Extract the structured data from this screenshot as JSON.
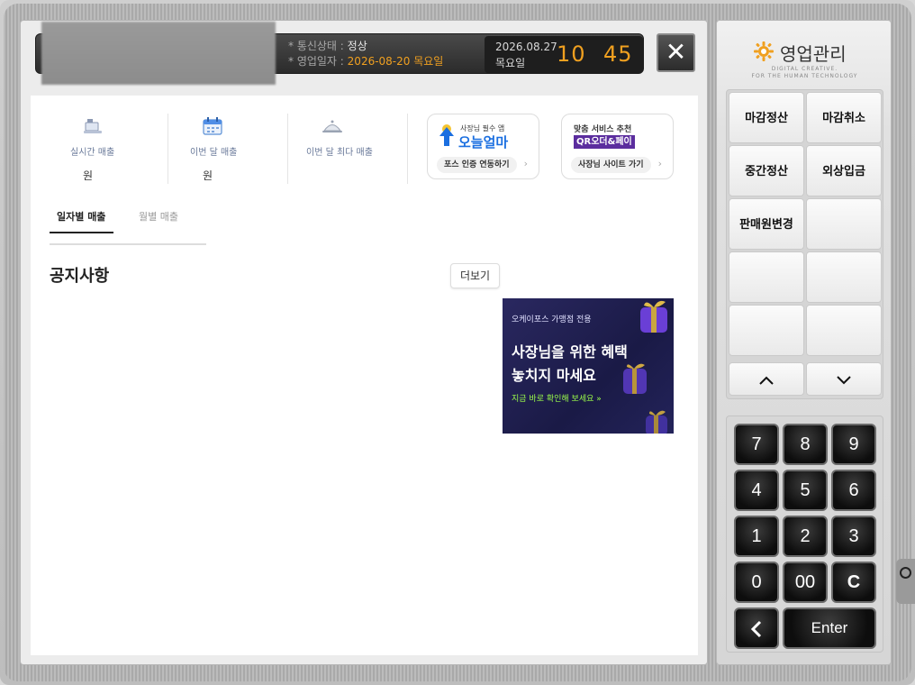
{
  "status_bar": {
    "comm_label": "* 통신상태 :",
    "comm_value": "정상",
    "bizdate_label": "* 영업일자 :",
    "bizdate_value": "2026-08-20 목요일",
    "current_date": "2026.08.27",
    "current_day": "목요일",
    "hour": "10",
    "minute": "45"
  },
  "stats": [
    {
      "label": "실시간 매출",
      "value": "원"
    },
    {
      "label": "이번 달 매출",
      "value": "원"
    },
    {
      "label": "이번 달 최다 매출",
      "value": ""
    }
  ],
  "promo_cards": [
    {
      "top_text": "사장님 필수 앱",
      "brand": "오늘얼마",
      "cta": "포스 인증 연동하기"
    },
    {
      "top_text": "맞춤 서비스 추천",
      "brand": "QR오더&페이",
      "cta": "사장님 사이트 가기"
    }
  ],
  "tabs": [
    "일자별 매출",
    "월별 매출"
  ],
  "notice": {
    "title": "공지사항",
    "more_label": "더보기"
  },
  "banner": {
    "small": "오케이포스 가맹점 전용",
    "line1": "사장님을 위한 혜택",
    "line2": "놓치지 마세요",
    "cta": "지금 바로 확인해 보세요 »"
  },
  "brand": {
    "title": "영업관리",
    "sub1": "DIGITAL CREATIVE.",
    "sub2": "FOR THE HUMAN TECHNOLOGY"
  },
  "function_buttons": [
    "마감정산",
    "마감취소",
    "중간정산",
    "외상입금",
    "판매원변경",
    "",
    "",
    "",
    "",
    ""
  ],
  "keypad": [
    "7",
    "8",
    "9",
    "4",
    "5",
    "6",
    "1",
    "2",
    "3",
    "0",
    "00",
    "C",
    "<",
    "Enter"
  ],
  "colors": {
    "accent_orange": "#f0a020",
    "banner_bg": "#1a1a46",
    "qr_purple": "#5b2d9e",
    "oneul_blue": "#1b6fe0"
  }
}
